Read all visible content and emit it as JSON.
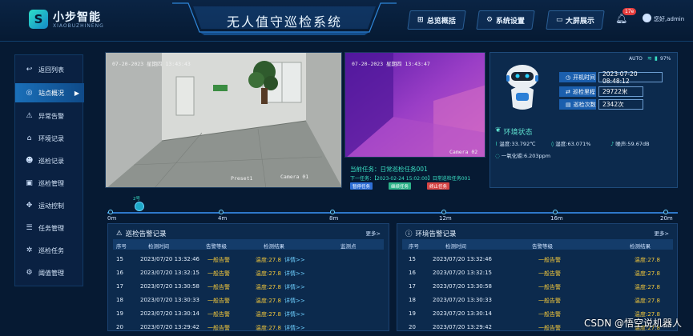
{
  "header": {
    "logo_name": "小步智能",
    "logo_sub": "XIAOBUZHINENG",
    "title": "无人值守巡检系统",
    "nav": [
      {
        "label": "总览概括",
        "icon": "grid-icon"
      },
      {
        "label": "系统设置",
        "icon": "gear-icon"
      },
      {
        "label": "大屏展示",
        "icon": "monitor-icon"
      }
    ],
    "notif_count": "17e",
    "user": "您好,admin"
  },
  "sidebar": {
    "items": [
      {
        "label": "返回列表",
        "icon": "back-icon"
      },
      {
        "label": "站点概况",
        "icon": "location-icon",
        "active": true
      },
      {
        "label": "异常告警",
        "icon": "warning-icon"
      },
      {
        "label": "环境记录",
        "icon": "env-icon"
      },
      {
        "label": "巡检记录",
        "icon": "patrol-icon"
      },
      {
        "label": "巡检管理",
        "icon": "manage-icon"
      },
      {
        "label": "运动控制",
        "icon": "control-icon"
      },
      {
        "label": "任务管理",
        "icon": "task-icon"
      },
      {
        "label": "巡检任务",
        "icon": "patrol-task-icon"
      },
      {
        "label": "阈值管理",
        "icon": "threshold-icon"
      }
    ]
  },
  "camera1": {
    "timestamp": "07-20-2023 星期四 13:43:43",
    "preset": "Preset1",
    "label": "Camera 01"
  },
  "camera2": {
    "timestamp": "07-20-2023 星期四 13:43:47",
    "label": "Camera 02"
  },
  "task": {
    "current": "当前任务：日常巡检任务001",
    "next": "下一任务：【2023-02-24 15:02:00】日常巡检任务001",
    "buttons": [
      {
        "label": "暂停任务",
        "color": "#2f6fd6"
      },
      {
        "label": "继续任务",
        "color": "#2db38a"
      },
      {
        "label": "终止任务",
        "color": "#d64545"
      }
    ]
  },
  "status": {
    "auto": "AUTO",
    "battery": "97%"
  },
  "robot_info": [
    {
      "label": "开机时间",
      "value": "2023-07-20 08:48:12"
    },
    {
      "label": "巡检里程",
      "value": "29722米"
    },
    {
      "label": "巡检次数",
      "value": "2342次"
    }
  ],
  "env": {
    "title": "环境状态",
    "temperature": "温度:33.792℃",
    "humidity": "湿度:63.071%",
    "noise": "噪声:59.67dB",
    "co": "一氧化碳:6.203ppm"
  },
  "timeline": {
    "labels": [
      "0m",
      "4m",
      "8m",
      "12m",
      "16m",
      "20m"
    ],
    "robot_tag": "2号"
  },
  "alarm_table": {
    "title": "巡检告警记录",
    "more": "更多>",
    "headers": [
      "序号",
      "检测时间",
      "告警等级",
      "检测结果",
      "监测点"
    ],
    "rows": [
      {
        "id": "15",
        "time": "2023/07/20 13:32:46",
        "level": "一般告警",
        "result": "温度:27.8",
        "detail": "详情>>"
      },
      {
        "id": "16",
        "time": "2023/07/20 13:32:15",
        "level": "一般告警",
        "result": "温度:27.8",
        "detail": "详情>>"
      },
      {
        "id": "17",
        "time": "2023/07/20 13:30:58",
        "level": "一般告警",
        "result": "温度:27.8",
        "detail": "详情>>"
      },
      {
        "id": "18",
        "time": "2023/07/20 13:30:33",
        "level": "一般告警",
        "result": "温度:27.8",
        "detail": "详情>>"
      },
      {
        "id": "19",
        "time": "2023/07/20 13:30:14",
        "level": "一般告警",
        "result": "温度:27.8",
        "detail": "详情>>"
      },
      {
        "id": "20",
        "time": "2023/07/20 13:29:42",
        "level": "一般告警",
        "result": "温度:27.8",
        "detail": "详情>>"
      }
    ]
  },
  "env_table": {
    "title": "环境告警记录",
    "more": "更多>",
    "headers": [
      "序号",
      "检测时间",
      "告警等级",
      "检测结果"
    ],
    "rows": [
      {
        "id": "15",
        "time": "2023/07/20 13:32:46",
        "level": "一般告警",
        "result": "温度:27.8"
      },
      {
        "id": "16",
        "time": "2023/07/20 13:32:15",
        "level": "一般告警",
        "result": "温度:27.8"
      },
      {
        "id": "17",
        "time": "2023/07/20 13:30:58",
        "level": "一般告警",
        "result": "温度:27.8"
      },
      {
        "id": "18",
        "time": "2023/07/20 13:30:33",
        "level": "一般告警",
        "result": "温度:27.8"
      },
      {
        "id": "19",
        "time": "2023/07/20 13:30:14",
        "level": "一般告警",
        "result": "温度:27.8"
      },
      {
        "id": "20",
        "time": "2023/07/20 13:29:42",
        "level": "一般告警",
        "result": "温度:27.8"
      }
    ]
  },
  "watermark": "CSDN @悟空说机器人"
}
